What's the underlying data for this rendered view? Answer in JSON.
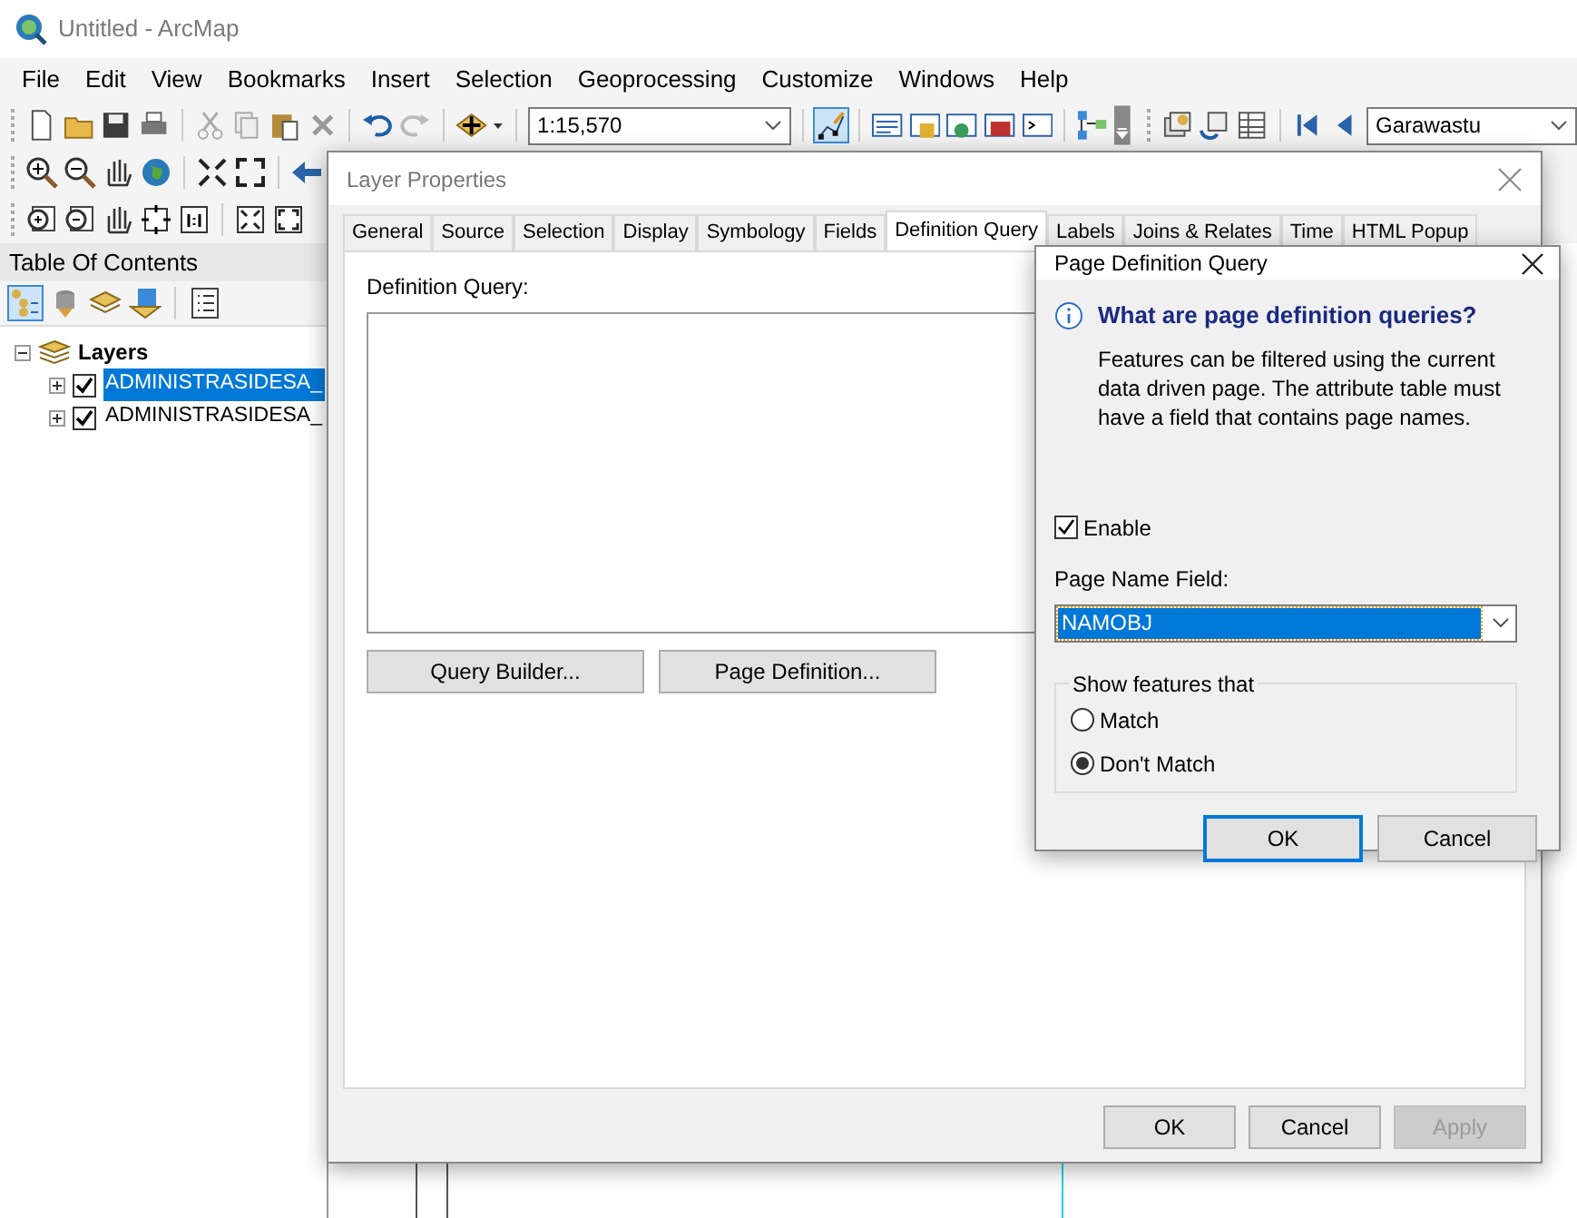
{
  "app": {
    "title": "Untitled - ArcMap"
  },
  "menu": [
    "File",
    "Edit",
    "View",
    "Bookmarks",
    "Insert",
    "Selection",
    "Geoprocessing",
    "Customize",
    "Windows",
    "Help"
  ],
  "toolbar": {
    "scale": "1:15,570",
    "page_combo": "Garawastu"
  },
  "toc": {
    "title": "Table Of Contents",
    "root": {
      "label": "Layers",
      "expanded": true,
      "children": [
        {
          "label": "ADMINISTRASIDESA_",
          "checked": true,
          "selected": true,
          "expanded": false
        },
        {
          "label": "ADMINISTRASIDESA_",
          "checked": true,
          "selected": false,
          "expanded": false
        }
      ]
    }
  },
  "layer_properties": {
    "title": "Layer Properties",
    "tabs": [
      {
        "label": "General",
        "selected": false
      },
      {
        "label": "Source",
        "selected": false
      },
      {
        "label": "Selection",
        "selected": false
      },
      {
        "label": "Display",
        "selected": false
      },
      {
        "label": "Symbology",
        "selected": false
      },
      {
        "label": "Fields",
        "selected": false
      },
      {
        "label": "Definition Query",
        "selected": true
      },
      {
        "label": "Labels",
        "selected": false
      },
      {
        "label": "Joins & Relates",
        "selected": false
      },
      {
        "label": "Time",
        "selected": false
      },
      {
        "label": "HTML Popup",
        "selected": false
      }
    ],
    "query_label": "Definition Query:",
    "query_buttons": [
      "Query Builder...",
      "Page Definition..."
    ],
    "footer_buttons": [
      {
        "label": "OK",
        "disabled": false
      },
      {
        "label": "Cancel",
        "disabled": false
      },
      {
        "label": "Apply",
        "disabled": true
      }
    ]
  },
  "page_query": {
    "title": "Page Definition Query",
    "heading": "What are page definition queries?",
    "description": "Features can be filtered using the current data driven page.  The attribute table must have a field that contains page names.",
    "enable": {
      "label": "Enable",
      "checked": true
    },
    "field_label": "Page Name Field:",
    "field_value": "NAMOBJ",
    "group_label": "Show features that",
    "options": [
      {
        "label": "Match",
        "selected": false
      },
      {
        "label": "Don't Match",
        "selected": true
      }
    ],
    "buttons": [
      {
        "label": "OK",
        "default": true
      },
      {
        "label": "Cancel",
        "default": false
      }
    ]
  }
}
